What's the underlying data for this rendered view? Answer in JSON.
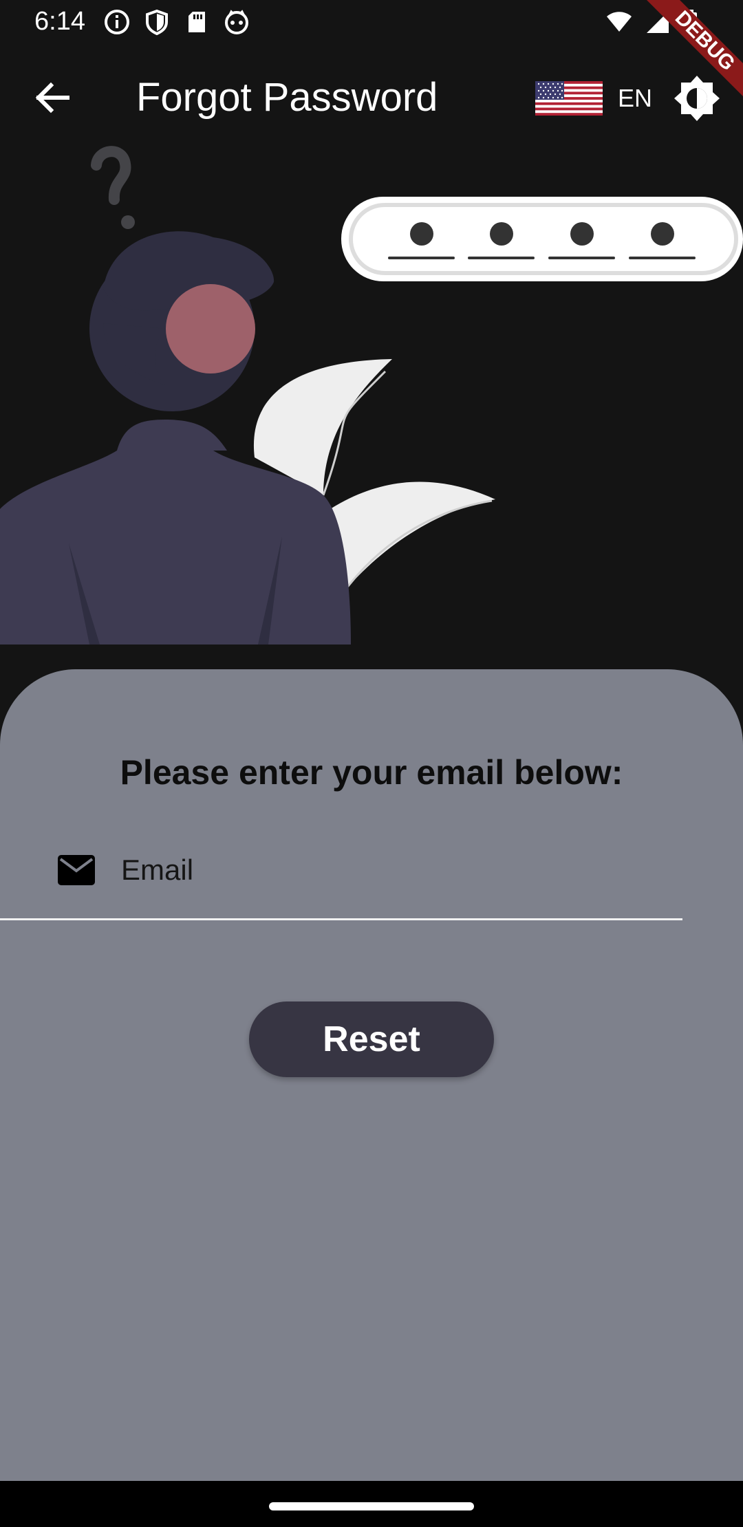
{
  "status_bar": {
    "time": "6:14",
    "left_icons": [
      "info-icon",
      "shield-icon",
      "sd-card-icon",
      "cat-face-icon"
    ],
    "right_icons": [
      "wifi-icon",
      "cellular-signal-icon",
      "battery-icon"
    ]
  },
  "debug_banner": {
    "label": "DEBUG",
    "color": "#8b1a1a"
  },
  "app_bar": {
    "title": "Forgot Password",
    "back_icon": "arrow-back-icon",
    "flag_icon": "us-flag-icon",
    "language": "EN",
    "theme_icon": "brightness-icon"
  },
  "illustration": {
    "description_icon": "confused-person-password-illustration"
  },
  "form": {
    "heading": "Please enter your email below:",
    "email": {
      "placeholder": "Email",
      "value": "",
      "icon": "mail-icon"
    },
    "reset_label": "Reset"
  },
  "colors": {
    "background": "#141414",
    "card": "#7e818c",
    "button": "#373543",
    "person_body": "#3e3b52",
    "person_hair": "#2f2e41",
    "skin": "#9e616a"
  }
}
